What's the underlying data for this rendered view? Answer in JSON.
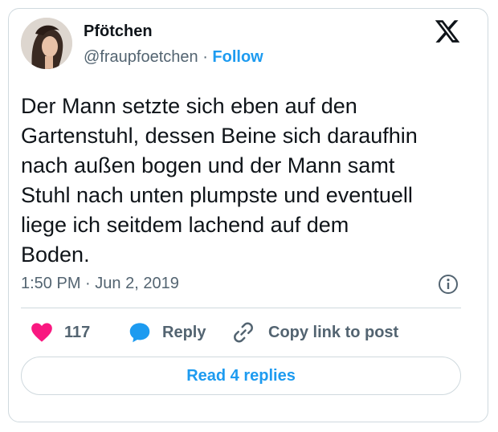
{
  "author": {
    "name": "Pfötchen",
    "handle": "@fraupfoetchen",
    "separator": "·",
    "follow_label": "Follow"
  },
  "tweet": {
    "lines": [
      "Der Mann setzte sich eben auf den",
      "Gartenstuhl, dessen Beine sich daraufhin",
      "nach außen bogen und der Mann samt",
      "Stuhl nach unten plumpste und eventuell",
      "liege ich seitdem lachend auf dem",
      "Boden."
    ],
    "time": "1:50 PM",
    "date_separator": "·",
    "date": "Jun 2, 2019"
  },
  "actions": {
    "like_count": "117",
    "reply_label": "Reply",
    "copy_label": "Copy link to post"
  },
  "read_replies_label": "Read 4 replies",
  "colors": {
    "accent": "#1d9bf0",
    "heart": "#f91880",
    "secondary_text": "#536471",
    "border": "#cfd9de"
  },
  "icons": [
    "x-logo-icon",
    "info-icon",
    "heart-icon",
    "reply-bubble-icon",
    "link-icon"
  ]
}
